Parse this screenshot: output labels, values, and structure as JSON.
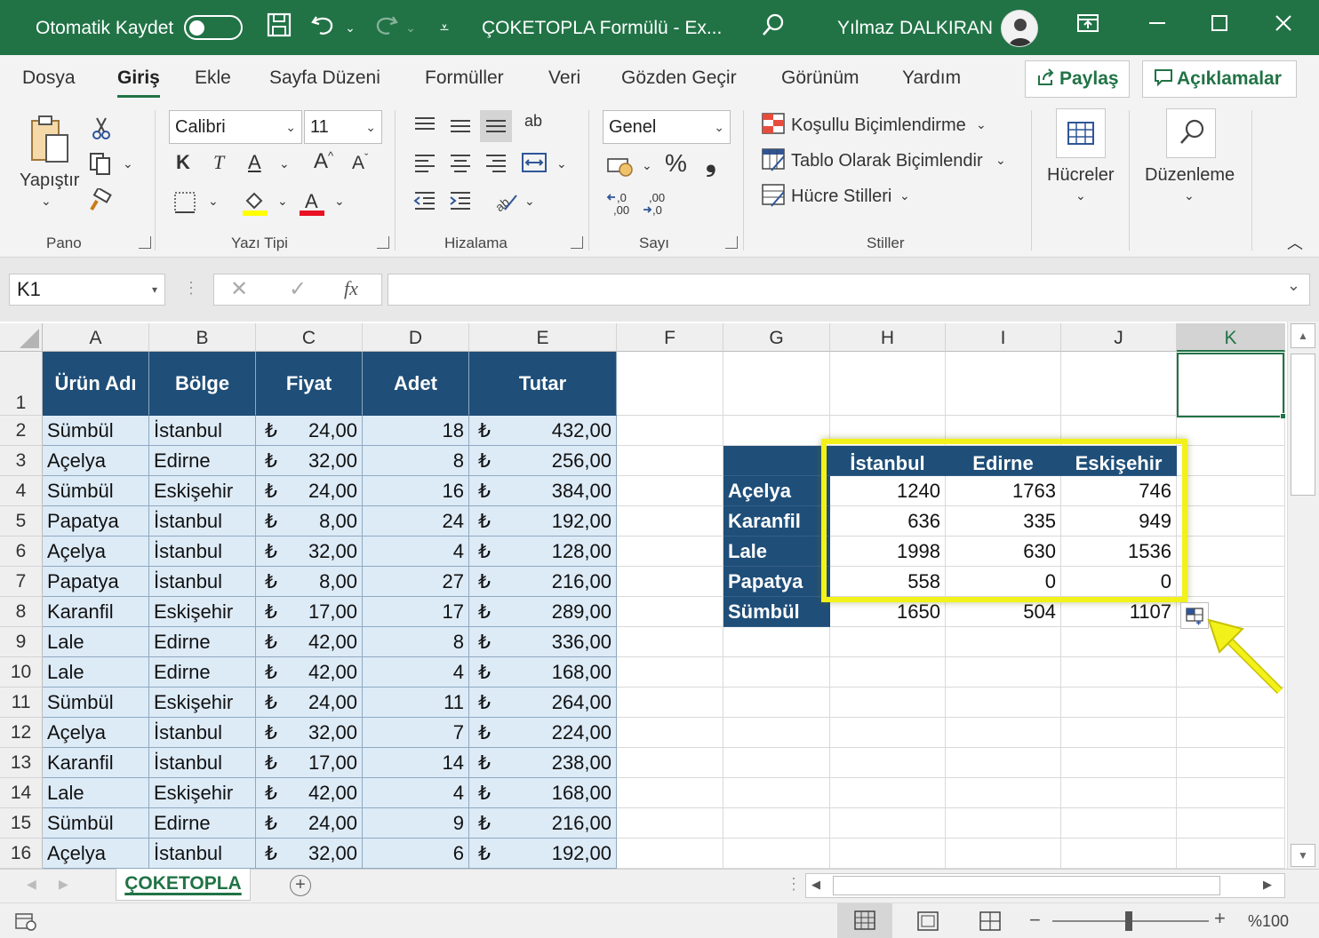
{
  "titlebar": {
    "autosave_label": "Otomatik Kaydet",
    "title": "ÇOKETOPLA Formülü  -  Ex...",
    "user": "Yılmaz DALKIRAN"
  },
  "tabs": [
    "Dosya",
    "Giriş",
    "Ekle",
    "Sayfa Düzeni",
    "Formüller",
    "Veri",
    "Gözden Geçir",
    "Görünüm",
    "Yardım"
  ],
  "share": {
    "share_label": "Paylaş",
    "comments_label": "Açıklamalar"
  },
  "ribbon": {
    "paste_label": "Yapıştır",
    "font_name": "Calibri",
    "font_size": "11",
    "number_format": "Genel",
    "bold": "K",
    "italic": "T",
    "underline": "A",
    "cond_format": "Koşullu Biçimlendirme",
    "format_table": "Tablo Olarak Biçimlendir",
    "cell_styles": "Hücre Stilleri",
    "cells": "Hücreler",
    "editing": "Düzenleme",
    "groups": {
      "clipboard": "Pano",
      "font": "Yazı Tipi",
      "alignment": "Hizalama",
      "number": "Sayı",
      "styles": "Stiller"
    },
    "percent": "%",
    "comma": "❟",
    "dec_increase": ",00",
    "dec_decrease": ",00",
    "wrap_icon_text": "ab"
  },
  "formula_bar": {
    "name_box": "K1",
    "fx": "fx",
    "content": ""
  },
  "columns": [
    "A",
    "B",
    "C",
    "D",
    "E",
    "F",
    "G",
    "H",
    "I",
    "J",
    "K"
  ],
  "row_numbers": [
    "1",
    "2",
    "3",
    "4",
    "5",
    "6",
    "7",
    "8",
    "9",
    "10",
    "11",
    "12",
    "13",
    "14",
    "15",
    "16"
  ],
  "table": {
    "headers": [
      "Ürün Adı",
      "Bölge",
      "Fiyat",
      "Adet",
      "Tutar"
    ],
    "currency_symbol": "₺",
    "rows": [
      [
        "Sümbül",
        "İstanbul",
        "24,00",
        "18",
        "432,00"
      ],
      [
        "Açelya",
        "Edirne",
        "32,00",
        "8",
        "256,00"
      ],
      [
        "Sümbül",
        "Eskişehir",
        "24,00",
        "16",
        "384,00"
      ],
      [
        "Papatya",
        "İstanbul",
        "8,00",
        "24",
        "192,00"
      ],
      [
        "Açelya",
        "İstanbul",
        "32,00",
        "4",
        "128,00"
      ],
      [
        "Papatya",
        "İstanbul",
        "8,00",
        "27",
        "216,00"
      ],
      [
        "Karanfil",
        "Eskişehir",
        "17,00",
        "17",
        "289,00"
      ],
      [
        "Lale",
        "Edirne",
        "42,00",
        "8",
        "336,00"
      ],
      [
        "Lale",
        "Edirne",
        "42,00",
        "4",
        "168,00"
      ],
      [
        "Sümbül",
        "Eskişehir",
        "24,00",
        "11",
        "264,00"
      ],
      [
        "Açelya",
        "İstanbul",
        "32,00",
        "7",
        "224,00"
      ],
      [
        "Karanfil",
        "İstanbul",
        "17,00",
        "14",
        "238,00"
      ],
      [
        "Lale",
        "Eskişehir",
        "42,00",
        "4",
        "168,00"
      ],
      [
        "Sümbül",
        "Edirne",
        "24,00",
        "9",
        "216,00"
      ],
      [
        "Açelya",
        "İstanbul",
        "32,00",
        "6",
        "192,00"
      ]
    ]
  },
  "summary": {
    "headers": [
      "İstanbul",
      "Edirne",
      "Eskişehir"
    ],
    "rows": [
      {
        "label": "Açelya",
        "values": [
          "1240",
          "1763",
          "746"
        ]
      },
      {
        "label": "Karanfil",
        "values": [
          "636",
          "335",
          "949"
        ]
      },
      {
        "label": "Lale",
        "values": [
          "1998",
          "630",
          "1536"
        ]
      },
      {
        "label": "Papatya",
        "values": [
          "558",
          "0",
          "0"
        ]
      },
      {
        "label": "Sümbül",
        "values": [
          "1650",
          "504",
          "1107"
        ]
      }
    ]
  },
  "sheet_tab": "ÇOKETOPLA",
  "status": {
    "zoom": "%100"
  },
  "colors": {
    "excel_green": "#217346",
    "header_blue": "#1f4e78",
    "band_blue": "#ddebf7",
    "highlight_yellow": "#f2f21a"
  }
}
